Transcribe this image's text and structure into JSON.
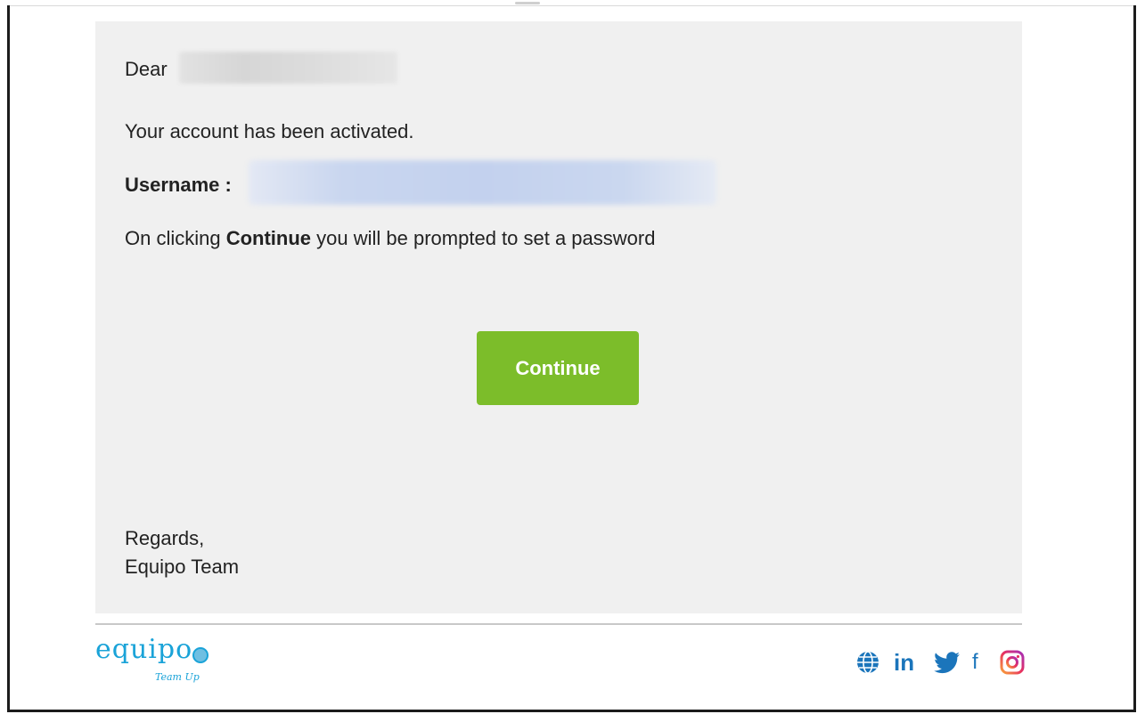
{
  "email": {
    "greeting": "Dear",
    "activation_message": "Your account has been activated.",
    "username_label": "Username :",
    "instruction_prefix": "On clicking ",
    "instruction_bold": "Continue",
    "instruction_suffix": " you will be prompted to set a password",
    "continue_label": "Continue",
    "regards": "Regards,",
    "signature": "Equipo Team"
  },
  "footer": {
    "logo_text": "equipo",
    "logo_tagline": "Team Up",
    "social_icons": [
      "globe-icon",
      "linkedin-icon",
      "twitter-icon",
      "facebook-icon",
      "instagram-icon"
    ],
    "linkedin_label": "in",
    "facebook_label": "f"
  },
  "colors": {
    "button": "#7cbd2a",
    "body_background": "#f0f0f0",
    "brand": "#1aa3d8",
    "social": "#1b75bb"
  }
}
